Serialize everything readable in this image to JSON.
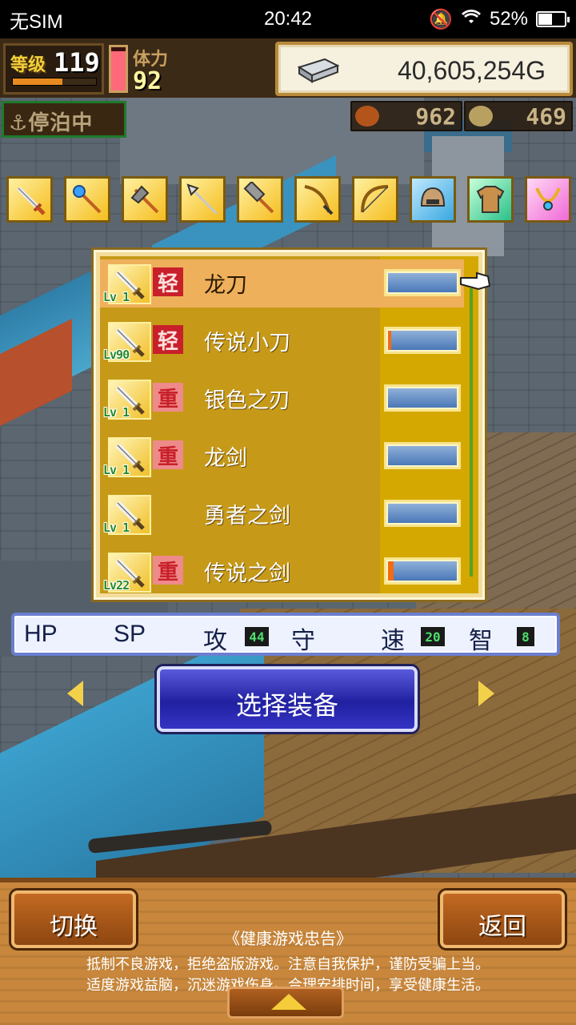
{
  "status_bar": {
    "carrier": "无SIM",
    "time": "20:42",
    "battery": "52%",
    "battery_level": 0.52
  },
  "hud": {
    "level_label": "等级",
    "level": "119",
    "level_progress": 0.6,
    "stamina_label": "体力",
    "stamina": "92",
    "stamina_level": 0.9,
    "gold": "40,605,254G",
    "docked": "停泊中",
    "resource_a": "962",
    "resource_b": "469"
  },
  "categories": [
    {
      "icon": "sword-icon",
      "selected": true
    },
    {
      "icon": "staff-icon",
      "selected": false
    },
    {
      "icon": "axe-icon",
      "selected": false
    },
    {
      "icon": "spear-icon",
      "selected": false
    },
    {
      "icon": "hammer-icon",
      "selected": false
    },
    {
      "icon": "whip-icon",
      "selected": false
    },
    {
      "icon": "bow-icon",
      "selected": false
    },
    {
      "icon": "helmet-icon",
      "selected": false
    },
    {
      "icon": "armor-icon",
      "selected": false
    },
    {
      "icon": "necklace-icon",
      "selected": false
    }
  ],
  "equipment": [
    {
      "lv": "Lv 1",
      "tag": "轻",
      "tag_type": "light",
      "name": "龙刀",
      "bar": 0.0,
      "selected": true
    },
    {
      "lv": "Lv90",
      "tag": "轻",
      "tag_type": "light",
      "name": "传说小刀",
      "bar": 0.04,
      "selected": false
    },
    {
      "lv": "Lv 1",
      "tag": "重",
      "tag_type": "heavy",
      "name": "银色之刃",
      "bar": 0.0,
      "selected": false
    },
    {
      "lv": "Lv 1",
      "tag": "重",
      "tag_type": "heavy",
      "name": "龙剑",
      "bar": 0.0,
      "selected": false
    },
    {
      "lv": "Lv 1",
      "tag": "",
      "tag_type": "none",
      "name": "勇者之剑",
      "bar": 0.0,
      "selected": false
    },
    {
      "lv": "Lv22",
      "tag": "重",
      "tag_type": "heavy",
      "name": "传说之剑",
      "bar": 0.08,
      "selected": false
    }
  ],
  "stats": {
    "hp_label": "HP",
    "sp_label": "SP",
    "atk_label": "攻",
    "atk": "44",
    "def_label": "守",
    "spd_label": "速",
    "spd": "20",
    "int_label": "智",
    "int": "8"
  },
  "select_button": "选择装备",
  "switch_button": "切换",
  "back_button": "返回",
  "notice": {
    "title": "《健康游戏忠告》",
    "line1": "抵制不良游戏，拒绝盗版游戏。注意自我保护，谨防受骗上当。",
    "line2": "适度游戏益脑，沉迷游戏伤身。合理安排时间，享受健康生活。"
  },
  "colors": {
    "selected_row": "#efb05c",
    "panel": "#c69a18",
    "select_button": "#2020a0",
    "wood": "#c8873c"
  }
}
